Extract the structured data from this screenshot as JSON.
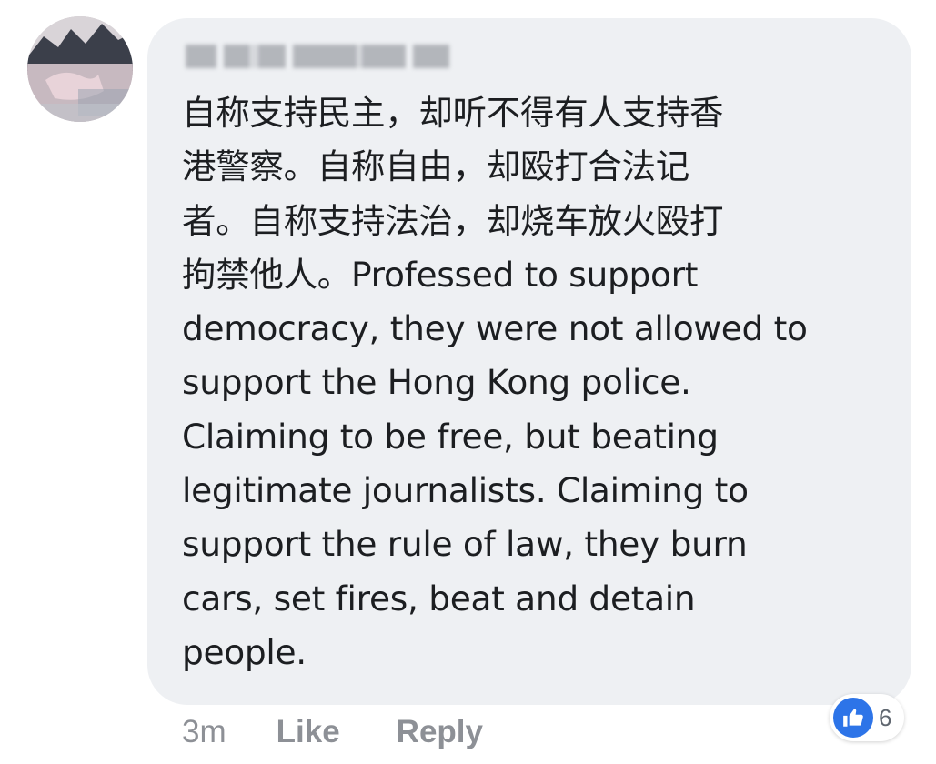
{
  "comment": {
    "avatar_icon": "profile-photo",
    "text": "自称支持民主，却听不得有人支持香\n港警察。自称自由，却殴打合法记\n者。自称支持法治，却烧车放火殴打\n拘禁他人。Professed to support\ndemocracy, they were not allowed to\nsupport the Hong Kong police.\nClaiming to be free, but beating\nlegitimate journalists. Claiming to\nsupport the rule of law, they burn\ncars, set fires, beat and detain\npeople.",
    "reaction_icon": "thumbs-up-icon",
    "reaction_count": "6",
    "timestamp": "3m",
    "like_label": "Like",
    "reply_label": "Reply"
  },
  "colors": {
    "bubble_bg": "#eef0f3",
    "text": "#1c1e21",
    "meta": "#8d9096",
    "like_blue": "#2d74e8"
  }
}
